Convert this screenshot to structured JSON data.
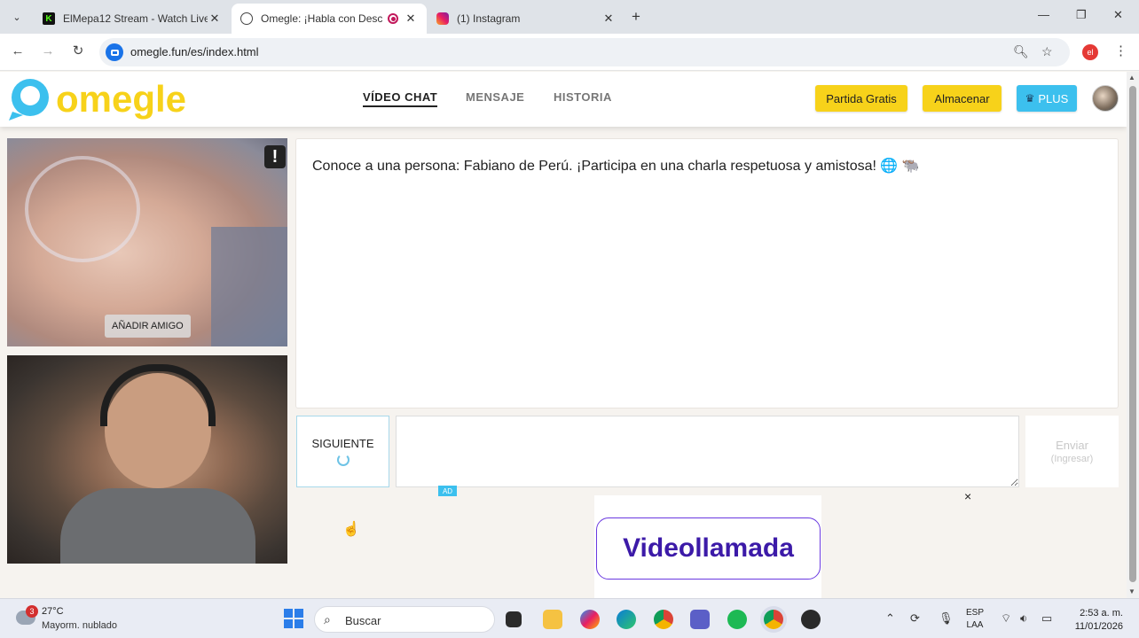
{
  "browser": {
    "tabs": [
      {
        "title": "ElMepa12 Stream - Watch Live",
        "favicon": "kick-icon",
        "favicon_color": "#53fc18"
      },
      {
        "title": "Omegle: ¡Habla con Descon",
        "favicon": "globe-icon",
        "recording": true,
        "active": true
      },
      {
        "title": "(1) Instagram",
        "favicon": "instagram-icon"
      }
    ],
    "url": "omegle.fun/es/index.html",
    "profile_initial": "el"
  },
  "site": {
    "logo_text": "omegle",
    "logo_colors": {
      "icon": "#3cc0ee",
      "text": "#f7d21a"
    },
    "nav": [
      {
        "label": "VÍDEO CHAT",
        "active": true
      },
      {
        "label": "MENSAJE",
        "active": false
      },
      {
        "label": "HISTORIA",
        "active": false
      }
    ],
    "buttons": {
      "free_match": "Partida Gratis",
      "store": "Almacenar",
      "plus": "PLUS",
      "plus_icon": "♛"
    }
  },
  "video": {
    "report_label": "!",
    "add_friend": "AÑADIR AMIGO"
  },
  "chat": {
    "message": "Conoce a una persona: Fabiano de Perú. ¡Participa en una charla respetuosa y amistosa! 🌐 🐃",
    "next_label": "SIGUIENTE",
    "input_value": "",
    "send_label": "Enviar",
    "send_sub": "(Ingresar)"
  },
  "ad": {
    "tag": "AD",
    "close": "×",
    "headline": "Videollamada"
  },
  "taskbar": {
    "weather_badge": "3",
    "temperature": "27°C",
    "weather_desc": "Mayorm. nublado",
    "search_placeholder": "Buscar",
    "lang_top": "ESP",
    "lang_bottom": "LAA",
    "time": "2:53 a. m.",
    "date": "11/01/2026"
  }
}
